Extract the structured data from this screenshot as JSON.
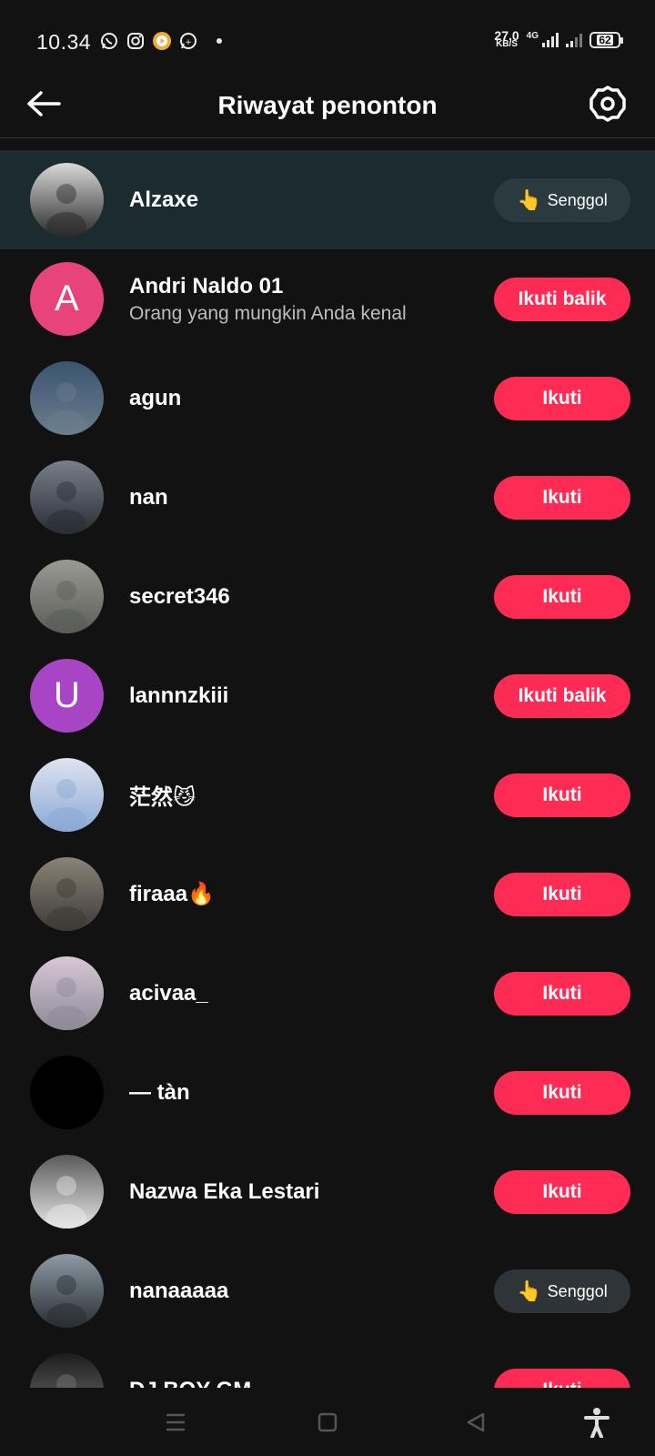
{
  "status_bar": {
    "time": "10.34",
    "net_speed_value": "27,0",
    "net_speed_unit": "KB/S",
    "network_type": "4G",
    "battery_level": "62",
    "left_icons": [
      "whatsapp-icon",
      "instagram-icon",
      "media-play-icon",
      "whatsapp-business-icon"
    ]
  },
  "header": {
    "title": "Riwayat penonton",
    "back_icon": "arrow-left-icon",
    "settings_icon": "settings-gear-icon"
  },
  "labels": {
    "follow": "Ikuti",
    "follow_back": "Ikuti balik",
    "nudge": "Senggol"
  },
  "viewers": [
    {
      "name": "Alzaxe",
      "subtitle": "",
      "action": "Senggol",
      "action_type": "nudge",
      "avatar": "photo",
      "highlighted": true
    },
    {
      "name": "Andri Naldo 01",
      "subtitle": "Orang yang mungkin Anda kenal",
      "action": "Ikuti balik",
      "action_type": "follow",
      "avatar": "letter",
      "avatar_letter": "A",
      "avatar_color": "#e8437b"
    },
    {
      "name": "agun",
      "subtitle": "",
      "action": "Ikuti",
      "action_type": "follow",
      "avatar": "photo"
    },
    {
      "name": "nan",
      "subtitle": "",
      "action": "Ikuti",
      "action_type": "follow",
      "avatar": "photo"
    },
    {
      "name": "secret346",
      "subtitle": "",
      "action": "Ikuti",
      "action_type": "follow",
      "avatar": "photo"
    },
    {
      "name": "lannnzkiii",
      "subtitle": "",
      "action": "Ikuti balik",
      "action_type": "follow",
      "avatar": "letter",
      "avatar_letter": "U",
      "avatar_color": "#a845c4"
    },
    {
      "name": "茫然😼",
      "subtitle": "",
      "action": "Ikuti",
      "action_type": "follow",
      "avatar": "photo"
    },
    {
      "name": "firaaa🔥",
      "subtitle": "",
      "action": "Ikuti",
      "action_type": "follow",
      "avatar": "photo"
    },
    {
      "name": "acivaa_",
      "subtitle": "",
      "action": "Ikuti",
      "action_type": "follow",
      "avatar": "photo"
    },
    {
      "name": "— tàn",
      "subtitle": "",
      "action": "Ikuti",
      "action_type": "follow",
      "avatar": "photo"
    },
    {
      "name": "Nazwa Eka Lestari",
      "subtitle": "",
      "action": "Ikuti",
      "action_type": "follow",
      "avatar": "photo"
    },
    {
      "name": "nanaaaaa",
      "subtitle": "",
      "action": "Senggol",
      "action_type": "nudge",
      "avatar": "photo"
    },
    {
      "name": "DJ BOY GM",
      "subtitle": "",
      "action": "Ikuti",
      "action_type": "follow",
      "avatar": "photo"
    }
  ],
  "navbar": {
    "items": [
      "menu-icon",
      "home-square-icon",
      "back-triangle-icon",
      "accessibility-icon"
    ]
  },
  "colors": {
    "background": "#121212",
    "follow_button": "#fe2c55",
    "nudge_button": "#2f3438",
    "highlight_row": "#1b2b30"
  }
}
